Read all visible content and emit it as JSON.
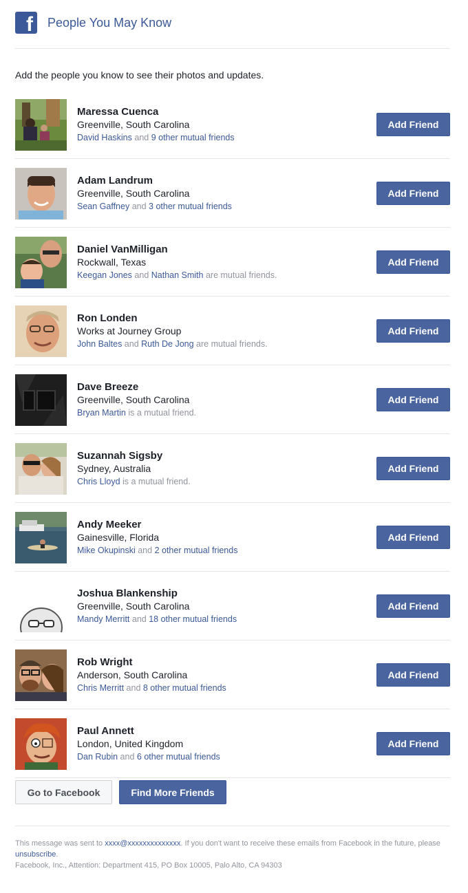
{
  "header": {
    "title": "People You May Know",
    "logo_letter": "f"
  },
  "intro": "Add the people you know to see their photos and updates.",
  "people": [
    {
      "name": "Maressa Cuenca",
      "location": "Greenville, South Carolina",
      "m1": "David Haskins",
      "mid": " and ",
      "m2": "9 other mutual friends",
      "tail": "",
      "button": "Add Friend"
    },
    {
      "name": "Adam Landrum",
      "location": "Greenville, South Carolina",
      "m1": "Sean Gaffney",
      "mid": " and ",
      "m2": "3 other mutual friends",
      "tail": "",
      "button": "Add Friend"
    },
    {
      "name": "Daniel VanMilligan",
      "location": "Rockwall, Texas",
      "m1": "Keegan Jones",
      "mid": " and ",
      "m2": "Nathan Smith",
      "tail": " are mutual friends.",
      "button": "Add Friend"
    },
    {
      "name": "Ron Londen",
      "location": "Works at Journey Group",
      "m1": "John Baltes",
      "mid": " and ",
      "m2": "Ruth De Jong",
      "tail": " are mutual friends.",
      "button": "Add Friend"
    },
    {
      "name": "Dave Breeze",
      "location": "Greenville, South Carolina",
      "m1": "Bryan Martin",
      "mid": " is a mutual friend.",
      "m2": "",
      "tail": "",
      "button": "Add Friend"
    },
    {
      "name": "Suzannah Sigsby",
      "location": "Sydney, Australia",
      "m1": "Chris Lloyd",
      "mid": " is a mutual friend.",
      "m2": "",
      "tail": "",
      "button": "Add Friend"
    },
    {
      "name": "Andy Meeker",
      "location": "Gainesville, Florida",
      "m1": "Mike Okupinski",
      "mid": " and ",
      "m2": "2 other mutual friends",
      "tail": "",
      "button": "Add Friend"
    },
    {
      "name": "Joshua Blankenship",
      "location": "Greenville, South Carolina",
      "m1": "Mandy Merritt",
      "mid": " and ",
      "m2": "18 other mutual friends",
      "tail": "",
      "button": "Add Friend"
    },
    {
      "name": "Rob Wright",
      "location": "Anderson, South Carolina",
      "m1": "Chris Merritt",
      "mid": " and ",
      "m2": "8 other mutual friends",
      "tail": "",
      "button": "Add Friend"
    },
    {
      "name": "Paul Annett",
      "location": "London, United Kingdom",
      "m1": "Dan Rubin",
      "mid": " and ",
      "m2": "6 other mutual friends",
      "tail": "",
      "button": "Add Friend"
    }
  ],
  "actions": {
    "go_label": "Go to Facebook",
    "more_label": "Find More Friends"
  },
  "footer": {
    "sent_prefix": "This message was sent to ",
    "email": "xxxx@xxxxxxxxxxxxxx",
    "sent_suffix": ". If you don't want to receive these emails from Facebook in the future, please ",
    "unsubscribe": "unsubscribe",
    "period": ".",
    "address": "Facebook, Inc., Attention: Department 415, PO Box 10005, Palo Alto, CA 94303"
  },
  "colors": {
    "brand": "#3b5998",
    "button": "#4a64a0",
    "muted": "#90949c"
  }
}
